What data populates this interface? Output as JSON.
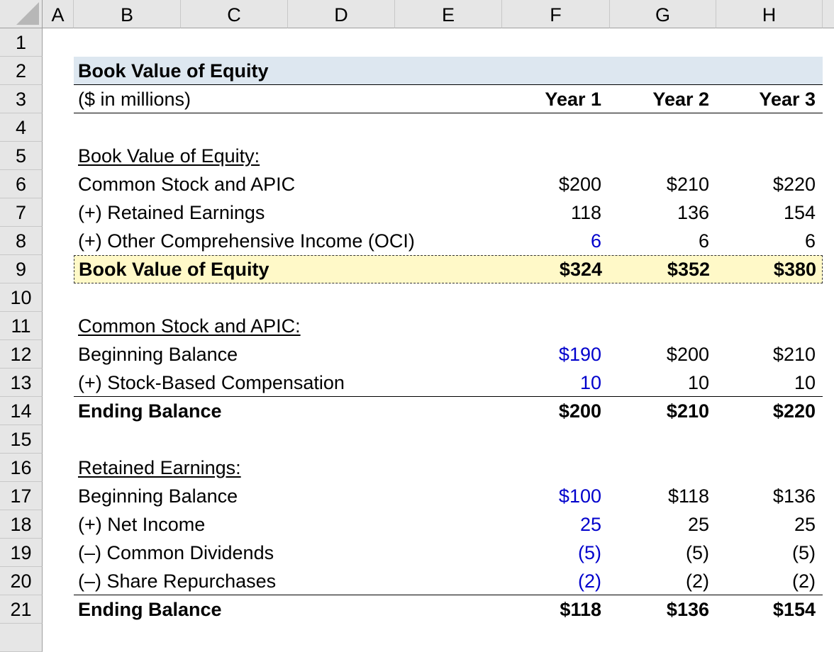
{
  "sheet": {
    "columns": [
      "A",
      "B",
      "C",
      "D",
      "E",
      "F",
      "G",
      "H"
    ],
    "rows": [
      "1",
      "2",
      "3",
      "4",
      "5",
      "6",
      "7",
      "8",
      "9",
      "10",
      "11",
      "12",
      "13",
      "14",
      "15",
      "16",
      "17",
      "18",
      "19",
      "20",
      "21"
    ]
  },
  "colors": {
    "input_blue": "#0000cc",
    "title_fill": "#dde7f0",
    "total_fill": "#fff9c8"
  },
  "title": "Book Value of Equity",
  "units": "($ in millions)",
  "years": [
    "Year 1",
    "Year 2",
    "Year 3"
  ],
  "bve": {
    "header": "Book Value of Equity:",
    "lines": [
      {
        "label": "Common Stock and APIC",
        "values": [
          "$200",
          "$210",
          "$220"
        ]
      },
      {
        "label": "(+) Retained Earnings",
        "values": [
          "118",
          "136",
          "154"
        ]
      },
      {
        "label": "(+) Other Comprehensive Income (OCI)",
        "values": [
          "6",
          "6",
          "6"
        ]
      }
    ],
    "total": {
      "label": "Book Value of Equity",
      "values": [
        "$324",
        "$352",
        "$380"
      ]
    }
  },
  "apic": {
    "header": "Common Stock and APIC:",
    "lines": [
      {
        "label": "Beginning Balance",
        "values": [
          "$190",
          "$200",
          "$210"
        ]
      },
      {
        "label": "(+) Stock-Based Compensation",
        "values": [
          "10",
          "10",
          "10"
        ]
      }
    ],
    "total": {
      "label": "Ending Balance",
      "values": [
        "$200",
        "$210",
        "$220"
      ]
    }
  },
  "re": {
    "header": "Retained Earnings:",
    "lines": [
      {
        "label": "Beginning Balance",
        "values": [
          "$100",
          "$118",
          "$136"
        ]
      },
      {
        "label": "(+) Net Income",
        "values": [
          "25",
          "25",
          "25"
        ]
      },
      {
        "label": "(–) Common Dividends",
        "values": [
          "(5)",
          "(5)",
          "(5)"
        ]
      },
      {
        "label": "(–) Share Repurchases",
        "values": [
          "(2)",
          "(2)",
          "(2)"
        ]
      }
    ],
    "total": {
      "label": "Ending Balance",
      "values": [
        "$118",
        "$136",
        "$154"
      ]
    }
  }
}
